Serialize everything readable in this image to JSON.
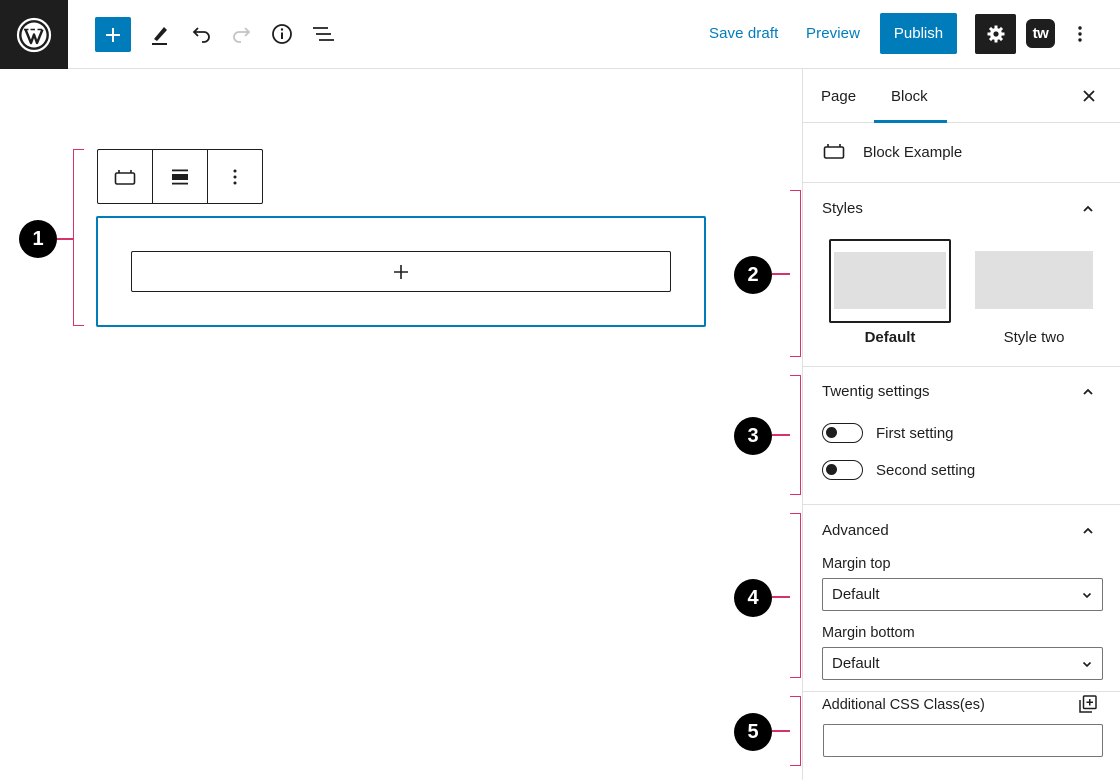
{
  "topbar": {
    "save_draft_label": "Save draft",
    "preview_label": "Preview",
    "publish_label": "Publish",
    "twentig_label": "tw",
    "accent_color": "#007cba"
  },
  "sidebar": {
    "tabs": [
      {
        "label": "Page"
      },
      {
        "label": "Block"
      }
    ],
    "block_card_title": "Block Example",
    "styles": {
      "title": "Styles",
      "options": [
        {
          "label": "Default"
        },
        {
          "label": "Style two"
        }
      ]
    },
    "twentig": {
      "title": "Twentig settings",
      "toggles": [
        {
          "label": "First setting"
        },
        {
          "label": "Second setting"
        }
      ]
    },
    "advanced": {
      "title": "Advanced",
      "margin_top_label": "Margin top",
      "margin_top_value": "Default",
      "margin_bottom_label": "Margin bottom",
      "margin_bottom_value": "Default",
      "css_class_label": "Additional CSS Class(es)",
      "css_class_value": ""
    }
  },
  "callouts": [
    "1",
    "2",
    "3",
    "4",
    "5"
  ],
  "annotation_color": "#d6336c"
}
